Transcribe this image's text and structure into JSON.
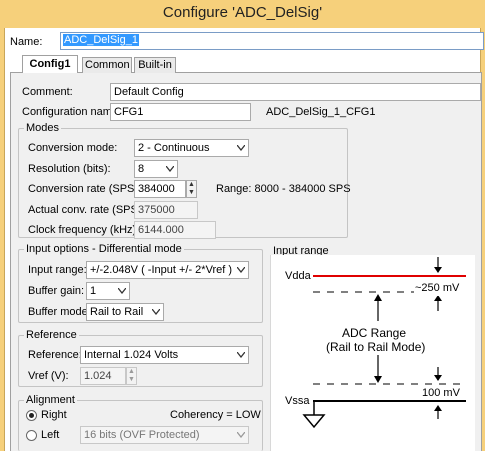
{
  "window": {
    "title": "Configure 'ADC_DelSig'"
  },
  "name": {
    "label": "Name:",
    "value": "ADC_DelSig_1"
  },
  "tabs": [
    {
      "label": "Config1"
    },
    {
      "label": "Common"
    },
    {
      "label": "Built-in"
    }
  ],
  "comment": {
    "label": "Comment:",
    "value": "Default Config"
  },
  "config_name": {
    "label": "Configuration name:",
    "value": "CFG1",
    "full_name": "ADC_DelSig_1_CFG1"
  },
  "modes": {
    "title": "Modes",
    "conversion_mode": {
      "label": "Conversion mode:",
      "value": "2 - Continuous"
    },
    "resolution": {
      "label": "Resolution (bits):",
      "value": "8"
    },
    "conversion_rate": {
      "label": "Conversion rate (SPS):",
      "value": "384000",
      "range": "Range: 8000 - 384000 SPS"
    },
    "actual_rate": {
      "label": "Actual conv. rate (SPS):",
      "value": "375000"
    },
    "clock_freq": {
      "label": "Clock frequency (kHz):",
      "value": "6144.000"
    }
  },
  "input_options": {
    "title": "Input options - Differential mode",
    "input_range": {
      "label": "Input range:",
      "value": "+/-2.048V ( -Input +/- 2*Vref )"
    },
    "buffer_gain": {
      "label": "Buffer gain:",
      "value": "1"
    },
    "buffer_mode": {
      "label": "Buffer mode:",
      "value": "Rail to Rail"
    }
  },
  "reference": {
    "title": "Reference",
    "reference": {
      "label": "Reference:",
      "value": "Internal 1.024 Volts"
    },
    "vref": {
      "label": "Vref (V):",
      "value": "1.024"
    }
  },
  "alignment": {
    "title": "Alignment",
    "right_label": "Right",
    "left_label": "Left",
    "coherency": "Coherency = LOW",
    "left_option": "16 bits (OVF Protected)",
    "selected": "Right"
  },
  "input_range_diagram": {
    "title": "Input range",
    "vdda": "Vdda",
    "vssa": "Vssa",
    "top_margin": "~250 mV",
    "bottom_margin": "100 mV",
    "adc_range": "ADC Range",
    "adc_mode": "(Rail to Rail Mode)",
    "colors": {
      "vdda_line": "#e00000",
      "vssa_line": "#000000"
    }
  }
}
